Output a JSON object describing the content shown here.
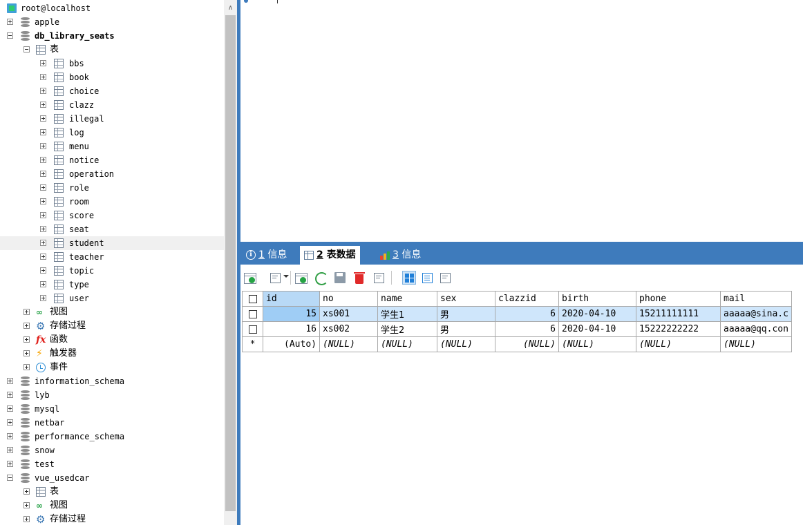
{
  "tree": {
    "connection": "root@localhost",
    "databases_top": [
      "apple"
    ],
    "current_db": "db_library_seats",
    "tables_node": "表",
    "tables": [
      "bbs",
      "book",
      "choice",
      "clazz",
      "illegal",
      "log",
      "menu",
      "notice",
      "operation",
      "role",
      "room",
      "score",
      "seat",
      "student",
      "teacher",
      "topic",
      "type",
      "user"
    ],
    "selected_table": "student",
    "other_nodes": [
      "视图",
      "存储过程",
      "函数",
      "触发器",
      "事件"
    ],
    "databases_rest": [
      "information_schema",
      "lyb",
      "mysql",
      "netbar",
      "performance_schema",
      "snow",
      "test",
      "vue_usedcar"
    ],
    "last_db_children": [
      "表",
      "视图",
      "存储过程"
    ]
  },
  "tabs": [
    {
      "num": "1",
      "label": " 信息"
    },
    {
      "num": "2",
      "label": " 表数据"
    },
    {
      "num": "3",
      "label": " 信息"
    }
  ],
  "grid": {
    "columns": [
      "id",
      "no",
      "name",
      "sex",
      "clazzid",
      "birth",
      "phone",
      "mail"
    ],
    "rows": [
      [
        "15",
        "xs001",
        "学生1",
        "男",
        "6",
        "2020-04-10",
        "15211111111",
        "aaaaa@sina.c"
      ],
      [
        "16",
        "xs002",
        "学生2",
        "男",
        "6",
        "2020-04-10",
        "15222222222",
        "aaaaa@qq.con"
      ]
    ],
    "new_row_marker": "*",
    "new_row": [
      "(Auto)",
      "(NULL)",
      "(NULL)",
      "(NULL)",
      "(NULL)",
      "(NULL)",
      "(NULL)",
      "(NULL)"
    ]
  }
}
